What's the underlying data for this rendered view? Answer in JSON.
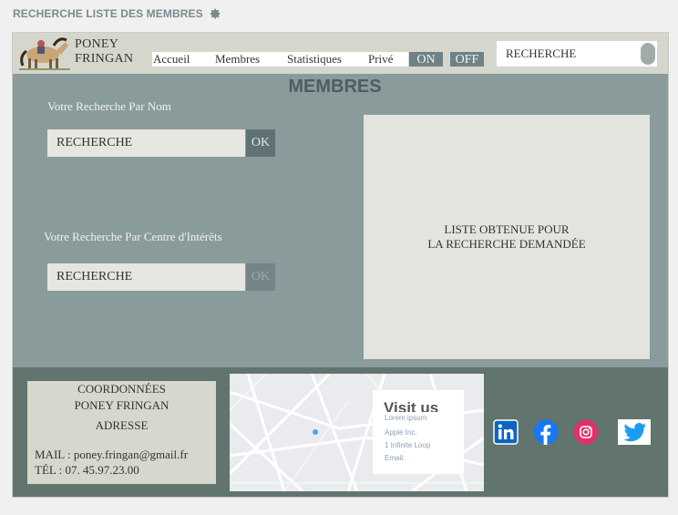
{
  "page": {
    "title": "RECHERCHE LISTE DES MEMBRES"
  },
  "header": {
    "brand_line1": "PONEY",
    "brand_line2": "FRINGAN",
    "nav": [
      "Accueil",
      "Membres",
      "Statistiques",
      "Privé"
    ],
    "on_label": "ON",
    "off_label": "OFF",
    "search_placeholder": "RECHERCHE"
  },
  "main": {
    "title": "MEMBRES",
    "by_name_label": "Votre Recherche Par Nom",
    "by_name_value": "RECHERCHE",
    "ok_label": "OK",
    "by_interest_label": "Votre Recherche Par Centre d'Intérêts",
    "by_interest_value": "RECHERCHE",
    "ok2_label": "OK",
    "results_line1": "LISTE OBTENUE POUR",
    "results_line2": "LA RECHERCHE DEMANDÉE"
  },
  "footer": {
    "contact_title1": "COORDONNÉES",
    "contact_title2": "PONEY FRINGAN",
    "contact_title3": "ADRESSE",
    "mail": "MAIL : poney.fringan@gmail.fr",
    "tel": "TÉL : 07. 45.97.23.00",
    "map_card": {
      "title": "Visit us",
      "line1": "Lorem ipsum",
      "line2": "Apple Inc.",
      "line3": "1 Infinite Loop",
      "line4": "Email:"
    },
    "social": [
      "linkedin-icon",
      "facebook-icon",
      "instagram-icon",
      "twitter-icon"
    ]
  },
  "colors": {
    "frame": "#8a9b9c",
    "header": "#d5d7cd",
    "footer": "#61746d",
    "panel": "#e3e4dd",
    "button": "#5f7275",
    "title": "#4d5d63"
  }
}
